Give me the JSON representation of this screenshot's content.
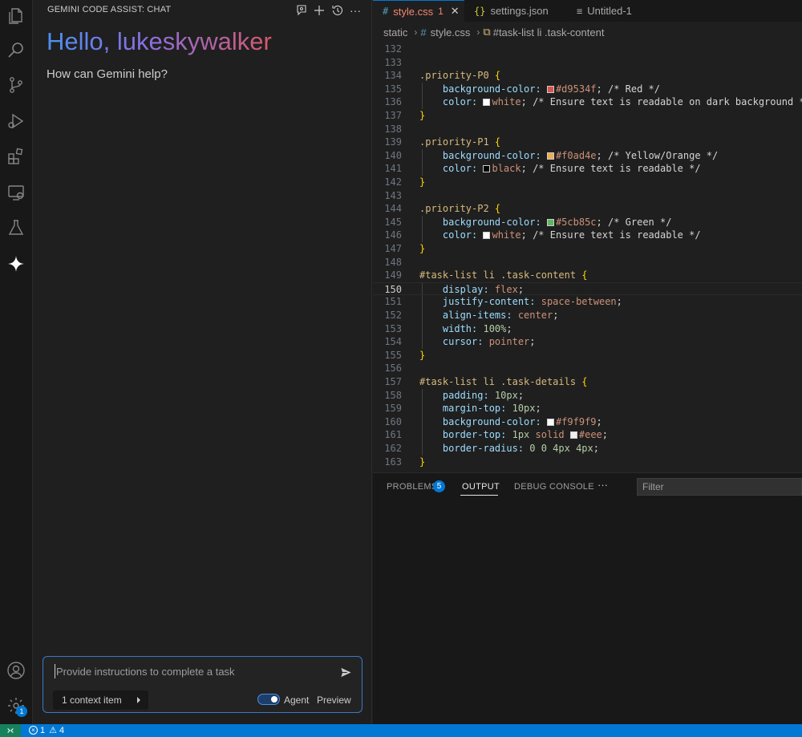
{
  "chat": {
    "title": "GEMINI CODE ASSIST: CHAT",
    "greeting": "Hello, lukeskywalker",
    "subtitle": "How can Gemini help?",
    "input_placeholder": "Provide instructions to complete a task",
    "context_label": "1 context item",
    "agent_label": "Agent",
    "preview_label": "Preview",
    "agent_enabled": true
  },
  "activity_bar": {
    "items": [
      "files-icon",
      "search-icon",
      "source-control-icon",
      "run-debug-icon",
      "extensions-icon",
      "remote-explorer-icon",
      "testing-icon",
      "gemini-icon"
    ],
    "bottom": [
      "account-icon",
      "manage-gear-icon"
    ],
    "settings_badge": "1"
  },
  "tabs": [
    {
      "label": "style.css",
      "icon": "#",
      "badge": "1",
      "active": true
    },
    {
      "label": "settings.json",
      "icon": "{}",
      "active": false
    },
    {
      "label": "Untitled-1",
      "icon": "≡",
      "active": false
    }
  ],
  "breadcrumb": [
    "static",
    "style.css",
    "#task-list li .task-content"
  ],
  "code_lines": [
    {
      "n": "132",
      "tokens": []
    },
    {
      "n": "133",
      "tokens": []
    },
    {
      "n": "134",
      "tokens": [
        [
          "sel",
          ".priority-P0 "
        ],
        [
          "br",
          "{"
        ]
      ]
    },
    {
      "n": "135",
      "guide": true,
      "tokens": [
        [
          "prop",
          "    background-color: "
        ],
        [
          "sw:#d9534f",
          ""
        ],
        [
          "val",
          "#d9534f"
        ],
        [
          "",
          "; "
        ],
        [
          "cmt",
          "/* Red */"
        ]
      ]
    },
    {
      "n": "136",
      "guide": true,
      "tokens": [
        [
          "prop",
          "    color: "
        ],
        [
          "sw:#ffffff",
          ""
        ],
        [
          "val",
          "white"
        ],
        [
          "",
          "; "
        ],
        [
          "cmt",
          "/* Ensure text is readable on dark background */"
        ]
      ]
    },
    {
      "n": "137",
      "tokens": [
        [
          "br",
          "}"
        ]
      ]
    },
    {
      "n": "138",
      "tokens": []
    },
    {
      "n": "139",
      "tokens": [
        [
          "sel",
          ".priority-P1 "
        ],
        [
          "br",
          "{"
        ]
      ]
    },
    {
      "n": "140",
      "guide": true,
      "tokens": [
        [
          "prop",
          "    background-color: "
        ],
        [
          "sw:#f0ad4e",
          ""
        ],
        [
          "val",
          "#f0ad4e"
        ],
        [
          "",
          "; "
        ],
        [
          "cmt",
          "/* Yellow/Orange */"
        ]
      ]
    },
    {
      "n": "141",
      "guide": true,
      "tokens": [
        [
          "prop",
          "    color: "
        ],
        [
          "sw:#000000",
          ""
        ],
        [
          "val",
          "black"
        ],
        [
          "",
          "; "
        ],
        [
          "cmt",
          "/* Ensure text is readable */"
        ]
      ]
    },
    {
      "n": "142",
      "tokens": [
        [
          "br",
          "}"
        ]
      ]
    },
    {
      "n": "143",
      "tokens": []
    },
    {
      "n": "144",
      "tokens": [
        [
          "sel",
          ".priority-P2 "
        ],
        [
          "br",
          "{"
        ]
      ]
    },
    {
      "n": "145",
      "guide": true,
      "tokens": [
        [
          "prop",
          "    background-color: "
        ],
        [
          "sw:#5cb85c",
          ""
        ],
        [
          "val",
          "#5cb85c"
        ],
        [
          "",
          "; "
        ],
        [
          "cmt",
          "/* Green */"
        ]
      ]
    },
    {
      "n": "146",
      "guide": true,
      "tokens": [
        [
          "prop",
          "    color: "
        ],
        [
          "sw:#ffffff",
          ""
        ],
        [
          "val",
          "white"
        ],
        [
          "",
          "; "
        ],
        [
          "cmt",
          "/* Ensure text is readable */"
        ]
      ]
    },
    {
      "n": "147",
      "tokens": [
        [
          "br",
          "}"
        ]
      ]
    },
    {
      "n": "148",
      "tokens": []
    },
    {
      "n": "149",
      "tokens": [
        [
          "sel",
          "#task-list li .task-content "
        ],
        [
          "br",
          "{"
        ]
      ]
    },
    {
      "n": "150",
      "guide": true,
      "current": true,
      "tokens": [
        [
          "prop",
          "    display: "
        ],
        [
          "val",
          "flex"
        ],
        [
          "",
          ";"
        ]
      ]
    },
    {
      "n": "151",
      "guide": true,
      "tokens": [
        [
          "prop",
          "    justify-content: "
        ],
        [
          "val",
          "space-between"
        ],
        [
          "",
          ";"
        ]
      ]
    },
    {
      "n": "152",
      "guide": true,
      "tokens": [
        [
          "prop",
          "    align-items: "
        ],
        [
          "val",
          "center"
        ],
        [
          "",
          ";"
        ]
      ]
    },
    {
      "n": "153",
      "guide": true,
      "tokens": [
        [
          "prop",
          "    width: "
        ],
        [
          "num",
          "100%"
        ],
        [
          "",
          ";"
        ]
      ]
    },
    {
      "n": "154",
      "guide": true,
      "tokens": [
        [
          "prop",
          "    cursor: "
        ],
        [
          "val",
          "pointer"
        ],
        [
          "",
          ";"
        ]
      ]
    },
    {
      "n": "155",
      "tokens": [
        [
          "br",
          "}"
        ]
      ]
    },
    {
      "n": "156",
      "tokens": []
    },
    {
      "n": "157",
      "tokens": [
        [
          "sel",
          "#task-list li .task-details "
        ],
        [
          "br",
          "{"
        ]
      ]
    },
    {
      "n": "158",
      "guide": true,
      "tokens": [
        [
          "prop",
          "    padding: "
        ],
        [
          "num",
          "10px"
        ],
        [
          "",
          ";"
        ]
      ]
    },
    {
      "n": "159",
      "guide": true,
      "tokens": [
        [
          "prop",
          "    margin-top: "
        ],
        [
          "num",
          "10px"
        ],
        [
          "",
          ";"
        ]
      ]
    },
    {
      "n": "160",
      "guide": true,
      "tokens": [
        [
          "prop",
          "    background-color: "
        ],
        [
          "sw:#f9f9f9",
          ""
        ],
        [
          "val",
          "#f9f9f9"
        ],
        [
          "",
          ";"
        ]
      ]
    },
    {
      "n": "161",
      "guide": true,
      "tokens": [
        [
          "prop",
          "    border-top: "
        ],
        [
          "num",
          "1px"
        ],
        [
          "",
          " "
        ],
        [
          "val",
          "solid "
        ],
        [
          "sw:#eeeeee",
          ""
        ],
        [
          "val",
          "#eee"
        ],
        [
          "",
          ";"
        ]
      ]
    },
    {
      "n": "162",
      "guide": true,
      "tokens": [
        [
          "prop",
          "    border-radius: "
        ],
        [
          "num",
          "0 0 4px 4px"
        ],
        [
          "",
          ";"
        ]
      ]
    },
    {
      "n": "163",
      "tokens": [
        [
          "br",
          "}"
        ]
      ]
    }
  ],
  "panel": {
    "tabs": [
      "PROBLEMS",
      "OUTPUT",
      "DEBUG CONSOLE"
    ],
    "problems_count": "5",
    "active_tab": "OUTPUT",
    "more": "···",
    "filter_placeholder": "Filter"
  },
  "status": {
    "errors": "1",
    "warnings": "4"
  },
  "colors": {
    "accent": "#0078d4",
    "remote": "#16825d",
    "error_tab": "#f48771"
  }
}
